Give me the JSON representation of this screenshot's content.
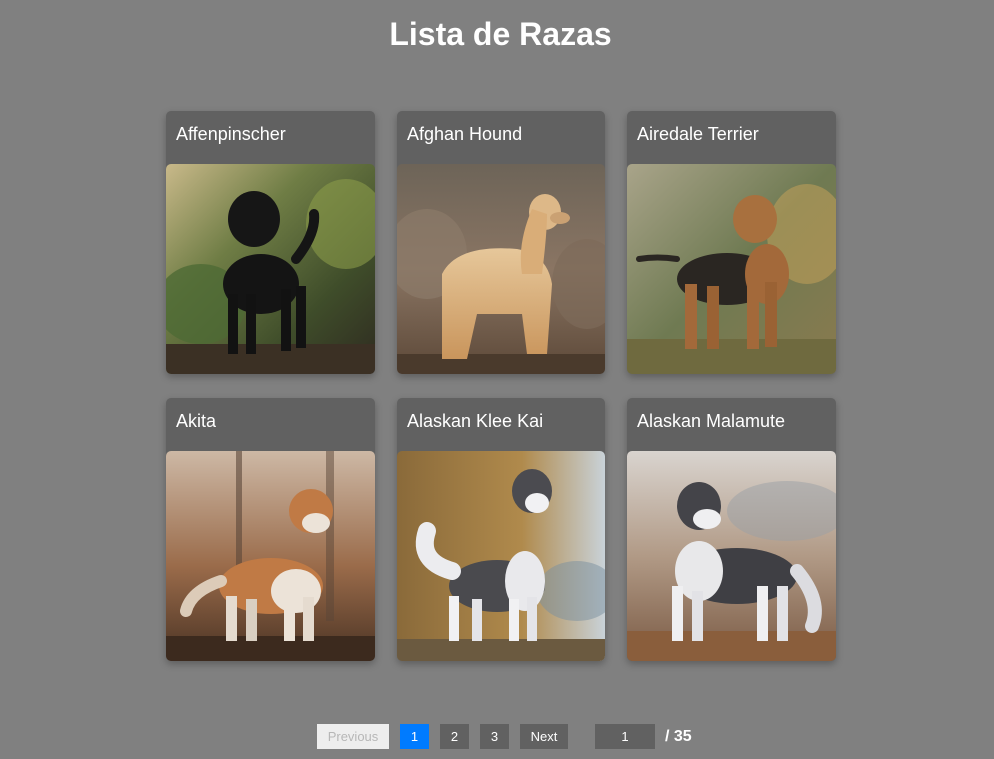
{
  "page": {
    "title": "Lista de Razas"
  },
  "breeds": [
    {
      "name": "Affenpinscher",
      "photo": "black-dog-photo"
    },
    {
      "name": "Afghan Hound",
      "photo": "long-haired-dog-photo"
    },
    {
      "name": "Airedale Terrier",
      "photo": "terrier-dog-photo"
    },
    {
      "name": "Akita",
      "photo": "akita-dog-photo"
    },
    {
      "name": "Alaskan Klee Kai",
      "photo": "husky-like-dog-photo"
    },
    {
      "name": "Alaskan Malamute",
      "photo": "malamute-dog-photo"
    }
  ],
  "pagination": {
    "previous_label": "Previous",
    "pages": [
      "1",
      "2",
      "3"
    ],
    "active_page": "1",
    "next_label": "Next",
    "page_input_value": "1",
    "total_label": "/ 35"
  },
  "colors": {
    "background": "#808080",
    "card": "#616161",
    "active_page": "#007bff",
    "disabled_button": "#eeeeee"
  }
}
